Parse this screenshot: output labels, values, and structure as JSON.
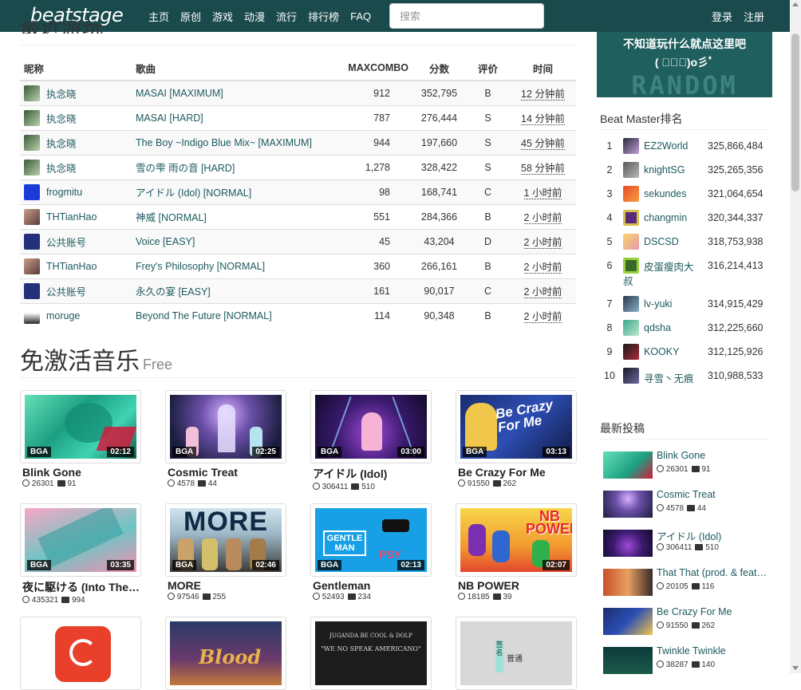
{
  "nav": {
    "logo": "beatstage",
    "links": [
      "主页",
      "原创",
      "游戏",
      "动漫",
      "流行",
      "排行榜",
      "FAQ"
    ],
    "search_placeholder": "搜索",
    "login": "登录",
    "register": "注册"
  },
  "recent": {
    "partial_title": "最近游玩",
    "headers": {
      "nick": "昵称",
      "song": "歌曲",
      "combo": "MAXCOMBO",
      "score": "分数",
      "grade": "评价",
      "time": "时间"
    },
    "rows": [
      {
        "nick": "执念晓",
        "song": "MASAI [MAXIMUM]",
        "combo": "912",
        "score": "352,795",
        "grade": "B",
        "time": "12 分钟前",
        "avatar": "leaf"
      },
      {
        "nick": "执念晓",
        "song": "MASAI [HARD]",
        "combo": "787",
        "score": "276,444",
        "grade": "S",
        "time": "14 分钟前",
        "avatar": "leaf"
      },
      {
        "nick": "执念晓",
        "song": "The Boy ~Indigo Blue Mix~ [MAXIMUM]",
        "combo": "944",
        "score": "197,660",
        "grade": "S",
        "time": "45 分钟前",
        "avatar": "leaf"
      },
      {
        "nick": "执念晓",
        "song": "雪の雫 雨の音 [HARD]",
        "combo": "1,278",
        "score": "328,422",
        "grade": "S",
        "time": "58 分钟前",
        "avatar": "leaf"
      },
      {
        "nick": "frogmitu",
        "song": "アイドル (Idol) [NORMAL]",
        "combo": "98",
        "score": "168,741",
        "grade": "C",
        "time": "1 小时前",
        "avatar": "pixel-blue"
      },
      {
        "nick": "THTianHao",
        "song": "神威 [NORMAL]",
        "combo": "551",
        "score": "284,366",
        "grade": "B",
        "time": "2 小时前",
        "avatar": "anime"
      },
      {
        "nick": "公共账号",
        "song": "Voice [EASY]",
        "combo": "45",
        "score": "43,204",
        "grade": "D",
        "time": "2 小时前",
        "avatar": "pixel-navy"
      },
      {
        "nick": "THTianHao",
        "song": "Frey's Philosophy [NORMAL]",
        "combo": "360",
        "score": "266,161",
        "grade": "B",
        "time": "2 小时前",
        "avatar": "anime"
      },
      {
        "nick": "公共账号",
        "song": "永久の宴 [EASY]",
        "combo": "161",
        "score": "90,017",
        "grade": "C",
        "time": "2 小时前",
        "avatar": "pixel-navy"
      },
      {
        "nick": "moruge",
        "song": "Beyond The Future [NORMAL]",
        "combo": "114",
        "score": "90,348",
        "grade": "B",
        "time": "2 小时前",
        "avatar": "girl"
      }
    ]
  },
  "free_music": {
    "title": "免激活音乐",
    "subtitle": "Free",
    "cards": [
      {
        "title": "Blink Gone",
        "plays": "26301",
        "comments": "91",
        "badge": "BGA",
        "duration": "02:12"
      },
      {
        "title": "Cosmic Treat",
        "plays": "4578",
        "comments": "44",
        "badge": "BGA",
        "duration": "02:25"
      },
      {
        "title": "アイドル (Idol)",
        "plays": "306411",
        "comments": "510",
        "badge": "BGA",
        "duration": "03:00"
      },
      {
        "title": "Be Crazy For Me",
        "plays": "91550",
        "comments": "262",
        "badge": "BGA",
        "duration": "03:13"
      },
      {
        "title": "夜に駆ける (Into The Night)",
        "plays": "435321",
        "comments": "994",
        "badge": "BGA",
        "duration": "03:35"
      },
      {
        "title": "MORE",
        "plays": "97546",
        "comments": "255",
        "badge": "BGA",
        "duration": "02:46"
      },
      {
        "title": "Gentleman",
        "plays": "52493",
        "comments": "234",
        "badge": "BGA",
        "duration": "02:13"
      },
      {
        "title": "NB POWER",
        "plays": "18185",
        "comments": "39",
        "badge": "",
        "duration": "02:07"
      }
    ],
    "thumb_texts": {
      "becrazy": "Be Crazy For Me",
      "more": "MORE",
      "gentleman": "GENTLE MAN",
      "psy": "PSY",
      "nbpower": "NB POWER",
      "blood": "Blood",
      "guanda": "JUGANDA BE COOL & DOLP",
      "guanda2": "\"WE NO SPEAK AMERICANO\"",
      "sign1": "签名",
      "sign2": "普通"
    }
  },
  "random": {
    "line1": "不知道玩什么就点这里吧",
    "line2": "( ﾟ∀ﾟ)o彡ﾟ",
    "bg_text": "RANDOM"
  },
  "ranking": {
    "title": "Beat Master排名",
    "items": [
      {
        "rank": "1",
        "name": "EZ2World",
        "score": "325,866,484"
      },
      {
        "rank": "2",
        "name": "knightSG",
        "score": "325,265,356"
      },
      {
        "rank": "3",
        "name": "sekundes",
        "score": "321,064,654"
      },
      {
        "rank": "4",
        "name": "changmin",
        "score": "320,344,337"
      },
      {
        "rank": "5",
        "name": "DSCSD",
        "score": "318,753,938"
      },
      {
        "rank": "6",
        "name": "皮蛋瘦肉大叔",
        "score": "316,214,413"
      },
      {
        "rank": "7",
        "name": "lv-yuki",
        "score": "314,915,429"
      },
      {
        "rank": "8",
        "name": "qdsha",
        "score": "312,225,660"
      },
      {
        "rank": "9",
        "name": "KOOKY",
        "score": "312,125,926"
      },
      {
        "rank": "10",
        "name": "寻雪丶无痕",
        "score": "310,988,533"
      }
    ]
  },
  "latest": {
    "title": "最新投稿",
    "items": [
      {
        "title": "Blink Gone",
        "plays": "26301",
        "comments": "91"
      },
      {
        "title": "Cosmic Treat",
        "plays": "4578",
        "comments": "44"
      },
      {
        "title": "アイドル (Idol)",
        "plays": "306411",
        "comments": "510"
      },
      {
        "title": "That That (prod. & feat. SUGA)",
        "plays": "20105",
        "comments": "116"
      },
      {
        "title": "Be Crazy For Me",
        "plays": "91550",
        "comments": "262"
      },
      {
        "title": "Twinkle Twinkle",
        "plays": "38287",
        "comments": "140"
      }
    ]
  },
  "colors": {
    "navbar": "#1a4a4c",
    "link": "#1d5a5e",
    "random_bg": "#1f5f5e"
  }
}
